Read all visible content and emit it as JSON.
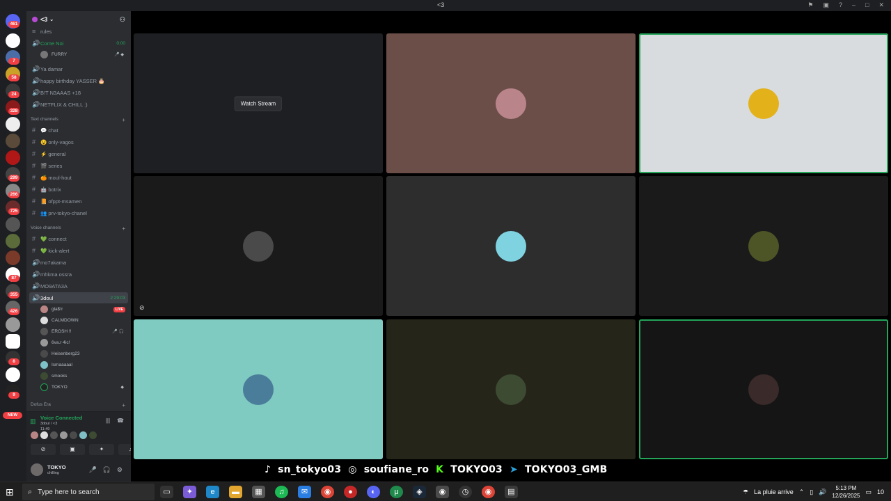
{
  "window": {
    "title": "<3"
  },
  "rail": {
    "badges": [
      "461",
      "7",
      "58",
      "24",
      "328",
      "299",
      "266",
      "725",
      "87",
      "355",
      "426",
      "8",
      "9"
    ],
    "new_label": "NEW"
  },
  "server": {
    "name": "<3"
  },
  "channels": {
    "top": [
      {
        "glyph": "≡",
        "label": "rules"
      },
      {
        "glyph": "🔊",
        "label": "Come Noi",
        "extra": "0:00"
      },
      {
        "glyph": "🔊",
        "label": "Ya damar"
      },
      {
        "glyph": "🔊",
        "label": "happy birthday YASSER 🎂"
      },
      {
        "glyph": "🔊",
        "label": "B!T N3AAAS +18"
      },
      {
        "glyph": "🔊",
        "label": "NETFLIX & CHILL :)"
      }
    ],
    "come_noi_user": "FURRY",
    "text_category": "Text channels",
    "text": [
      {
        "label": "💬 chat"
      },
      {
        "label": "😵 only-vagos"
      },
      {
        "label": "⚡ general"
      },
      {
        "label": "🎬 series"
      },
      {
        "label": "🍊 moul-hout"
      },
      {
        "label": "🤖 botrix"
      },
      {
        "label": "📙 ofppt-msamen"
      },
      {
        "label": "👥 prv-tokyo-chanel"
      }
    ],
    "voice_category": "Voice channels",
    "voice": [
      {
        "glyph": "#",
        "label": "💚 connect"
      },
      {
        "glyph": "#",
        "label": "💚 kick-alert"
      },
      {
        "glyph": "🔊",
        "label": "mo7akama"
      },
      {
        "glyph": "🔊",
        "label": "mhkma ossra"
      },
      {
        "glyph": "🔊",
        "label": "MO9ATA3A"
      }
    ],
    "active": {
      "label": "3doul",
      "timer": "2:29:03"
    },
    "members": [
      {
        "name": "gla$!r",
        "live": "LIVE"
      },
      {
        "name": "CALMDOWN"
      },
      {
        "name": "EROSH !!",
        "icons": "🎤 🎧"
      },
      {
        "name": "6va.r 4ic!"
      },
      {
        "name": "Heisenberg23"
      },
      {
        "name": "Ismaaaaal"
      },
      {
        "name": "smooks"
      },
      {
        "name": "TOKYO",
        "icons": "◆"
      }
    ],
    "bottom_category": "Dofus Era"
  },
  "voice_panel": {
    "status": "Voice Connected",
    "channel": "3doul / <3",
    "time": "11:49"
  },
  "user": {
    "name": "TOKYO",
    "status": "chilling"
  },
  "stage": {
    "watch_label": "Watch Stream",
    "tiles": [
      {
        "bg": "#1e1f22",
        "watch": true
      },
      {
        "bg": "#6b4e48",
        "avatar": "#b9848a"
      },
      {
        "bg": "#d8dcdf",
        "avatar": "#e3b11a",
        "speaking": true
      },
      {
        "bg": "#1a1a1a",
        "avatar": "#4a4a4a",
        "screen": true
      },
      {
        "bg": "#2d2d2d",
        "avatar": "#7fd2e0"
      },
      {
        "bg": "#1a1a1a",
        "avatar": "#4d5527"
      },
      {
        "bg": "#7fcac1",
        "avatar": "#4a7d9a"
      },
      {
        "bg": "#26251a",
        "avatar": "#3c4b32"
      },
      {
        "bg": "#151515",
        "avatar": "#3a2a2a",
        "speaking": true
      }
    ]
  },
  "overlay": {
    "tiktok": "sn_tokyo03",
    "instagram": "soufiane_ro",
    "kick": "TOKYO03",
    "telegram": "TOKYO03_GMB"
  },
  "taskbar": {
    "search_placeholder": "Type here to search",
    "weather": "La pluie arrive",
    "time": "5:13 PM",
    "date": "12/26/2025",
    "notif": "10"
  }
}
